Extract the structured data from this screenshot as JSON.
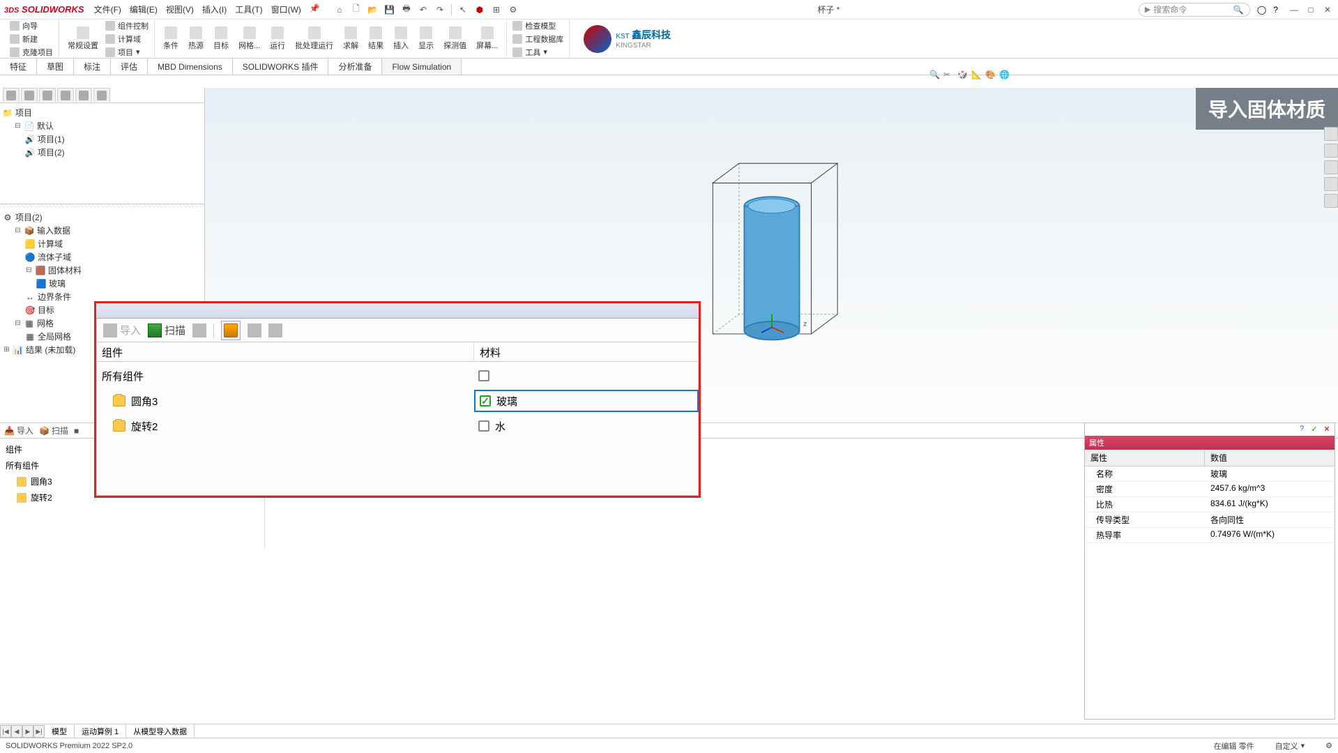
{
  "app_name": "SOLIDWORKS",
  "menus": [
    "文件(F)",
    "编辑(E)",
    "视图(V)",
    "插入(I)",
    "工具(T)",
    "窗口(W)"
  ],
  "document_title": "杯子 *",
  "search_placeholder": "搜索命令",
  "ribbon": {
    "c1a": "向导",
    "c1b": "新建",
    "c1c": "克隆项目",
    "c2a": "常规设置",
    "c2b": "组件控制",
    "c2c": "计算域",
    "c2d": "项目",
    "c3": [
      "条件",
      "热源",
      "目标",
      "网格...",
      "运行",
      "批处理运行",
      "求解",
      "结果",
      "插入",
      "显示",
      "探测值",
      "屏幕..."
    ],
    "c4a": "检查模型",
    "c4b": "工程数据库",
    "c4c": "工具",
    "company": "鑫辰科技",
    "company_sub": "KINGSTAR",
    "company_prefix": "KST"
  },
  "tabs": [
    "特征",
    "草图",
    "标注",
    "评估",
    "MBD Dimensions",
    "SOLIDWORKS 插件",
    "分析准备",
    "Flow Simulation"
  ],
  "overlay_text": "导入固体材质",
  "tree1": {
    "root": "项目",
    "default": "默认",
    "p1": "项目(1)",
    "p2": "项目(2)"
  },
  "tree2": {
    "root": "项目(2)",
    "input": "输入数据",
    "domain": "计算域",
    "fluid": "流体子域",
    "solid": "固体材料",
    "glass": "玻璃",
    "bc": "边界条件",
    "goal": "目标",
    "mesh": "网格",
    "global": "全局网格",
    "results": "结果 (未加载)"
  },
  "bp_toolbar": {
    "import": "导入",
    "scan": "扫描"
  },
  "bp_cols": {
    "component": "组件",
    "material": "材料"
  },
  "bp_rows": {
    "all": "所有组件",
    "r1": "圆角3",
    "r2": "旋转2"
  },
  "dlg": {
    "import": "导入",
    "scan": "扫描",
    "col1": "组件",
    "col2": "材料",
    "all": "所有组件",
    "r1": "圆角3",
    "r2": "旋转2",
    "mat_glass": "玻璃",
    "mat_water": "水"
  },
  "props": {
    "title": "属性",
    "h1": "属性",
    "h2": "数值",
    "rows": [
      {
        "k": "名称",
        "v": "玻璃"
      },
      {
        "k": "密度",
        "v": "2457.6 kg/m^3"
      },
      {
        "k": "比热",
        "v": "834.61 J/(kg*K)"
      },
      {
        "k": "传导类型",
        "v": "各向同性"
      },
      {
        "k": "热导率",
        "v": "0.74976 W/(m*K)"
      }
    ]
  },
  "bottom_tabs": [
    "模型",
    "运动算例 1",
    "从模型导入数据"
  ],
  "status": {
    "version": "SOLIDWORKS Premium 2022 SP2.0",
    "editing": "在编辑 零件",
    "custom": "自定义"
  },
  "axis_z": "z"
}
